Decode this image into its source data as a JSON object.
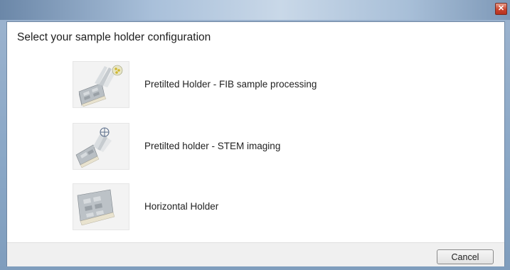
{
  "window": {
    "title": ""
  },
  "dialog": {
    "heading": "Select your sample holder configuration",
    "options": [
      {
        "label": "Pretilted Holder - FIB sample processing",
        "icon": "pretilted-fib-holder-image"
      },
      {
        "label": "Pretilted holder - STEM imaging",
        "icon": "pretilted-stem-holder-image"
      },
      {
        "label": "Horizontal Holder",
        "icon": "horizontal-holder-image"
      }
    ],
    "cancel_label": "Cancel"
  },
  "colors": {
    "titlebar_accent": "#a9c0da",
    "close_button": "#c9432d",
    "footer_bg": "#f0f0f0"
  }
}
